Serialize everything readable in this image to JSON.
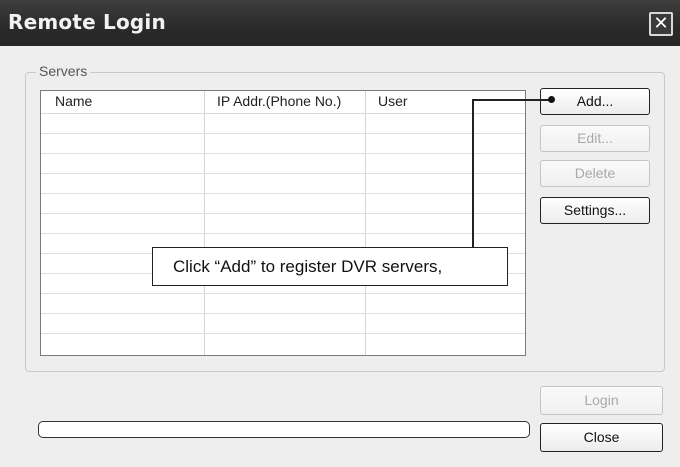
{
  "window": {
    "title": "Remote Login",
    "close_glyph": "✕"
  },
  "servers": {
    "group_label": "Servers",
    "columns": [
      "Name",
      "IP Addr.(Phone No.)",
      "User"
    ],
    "rows": []
  },
  "buttons": {
    "add": "Add...",
    "edit": "Edit...",
    "delete": "Delete",
    "settings": "Settings...",
    "login": "Login",
    "close": "Close"
  },
  "callout": {
    "text": "Click “Add” to register DVR servers,"
  },
  "progress": {
    "value": 0
  }
}
